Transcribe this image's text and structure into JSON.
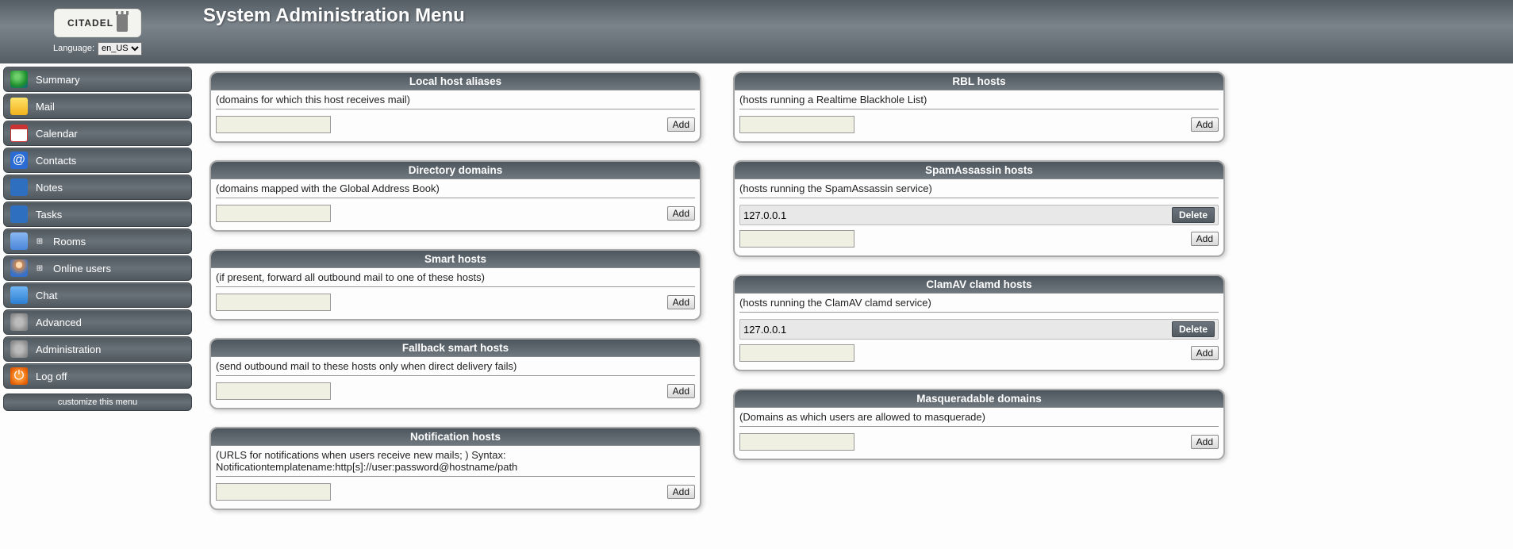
{
  "header": {
    "logo_text": "CITADEL",
    "language_label": "Language:",
    "language_value": "en_US",
    "page_title": "System Administration Menu"
  },
  "sidebar": {
    "items": [
      {
        "label": "Summary",
        "expandable": false
      },
      {
        "label": "Mail",
        "expandable": false
      },
      {
        "label": "Calendar",
        "expandable": false
      },
      {
        "label": "Contacts",
        "expandable": false
      },
      {
        "label": "Notes",
        "expandable": false
      },
      {
        "label": "Tasks",
        "expandable": false
      },
      {
        "label": "Rooms",
        "expandable": true
      },
      {
        "label": "Online users",
        "expandable": true
      },
      {
        "label": "Chat",
        "expandable": false
      },
      {
        "label": "Advanced",
        "expandable": false
      },
      {
        "label": "Administration",
        "expandable": false
      },
      {
        "label": "Log off",
        "expandable": false
      }
    ],
    "customize_label": "customize this menu"
  },
  "buttons": {
    "add": "Add",
    "delete": "Delete"
  },
  "col1": [
    {
      "title": "Local host aliases",
      "desc": "(domains for which this host receives mail)",
      "entries": []
    },
    {
      "title": "Directory domains",
      "desc": "(domains mapped with the Global Address Book)",
      "entries": []
    },
    {
      "title": "Smart hosts",
      "desc": "(if present, forward all outbound mail to one of these hosts)",
      "entries": []
    },
    {
      "title": "Fallback smart hosts",
      "desc": "(send outbound mail to these hosts only when direct delivery fails)",
      "entries": []
    },
    {
      "title": "Notification hosts",
      "desc": "(URLS for notifications when users receive new mails; ) Syntax: Notificationtemplatename:http[s]://user:password@hostname/path",
      "entries": []
    }
  ],
  "col2": [
    {
      "title": "RBL hosts",
      "desc": "(hosts running a Realtime Blackhole List)",
      "entries": []
    },
    {
      "title": "SpamAssassin hosts",
      "desc": "(hosts running the SpamAssassin service)",
      "entries": [
        "127.0.0.1"
      ]
    },
    {
      "title": "ClamAV clamd hosts",
      "desc": "(hosts running the ClamAV clamd service)",
      "entries": [
        "127.0.0.1"
      ]
    },
    {
      "title": "Masqueradable domains",
      "desc": "(Domains as which users are allowed to masquerade)",
      "entries": []
    }
  ]
}
